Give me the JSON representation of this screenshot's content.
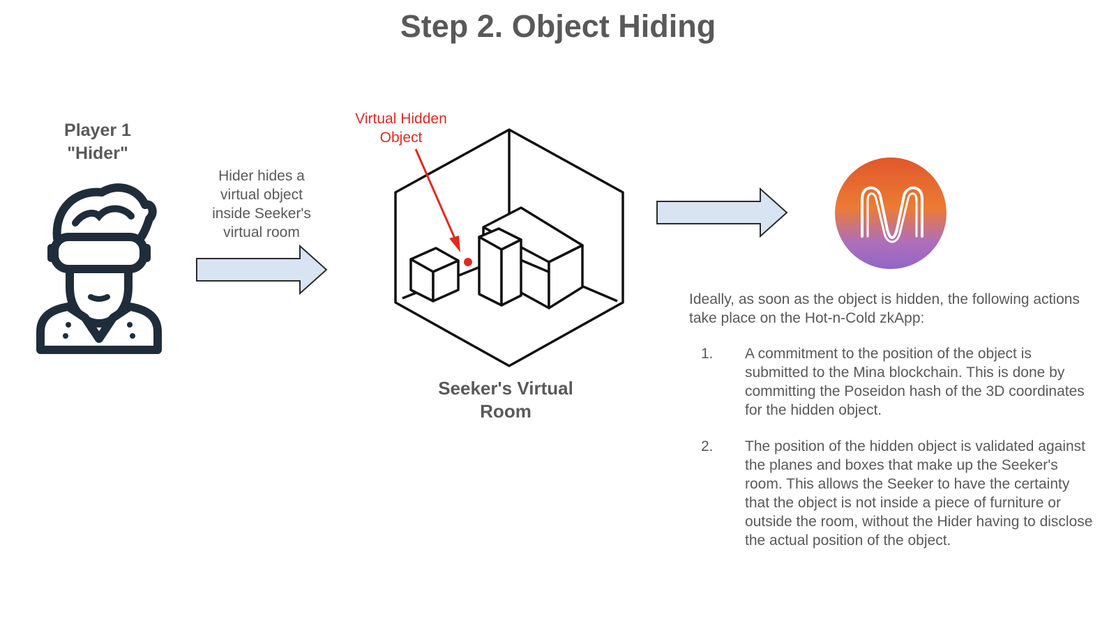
{
  "title": "Step 2. Object Hiding",
  "player": {
    "line1": "Player 1",
    "line2": "\"Hider\"",
    "icon": "vr-headset-user-icon"
  },
  "step_caption": {
    "lines": [
      "Hider hides a",
      "virtual object",
      "inside Seeker's",
      "virtual room"
    ]
  },
  "room": {
    "hidden_label": [
      "Virtual Hidden",
      "Object"
    ],
    "caption": [
      "Seeker's Virtual",
      "Room"
    ],
    "icon": "isometric-room-icon",
    "hidden_marker_color": "#e02a20"
  },
  "mina": {
    "icon": "mina-logo-icon",
    "gradient": [
      "#e0572a",
      "#ec7b34",
      "#b06fb8",
      "#9166c9"
    ]
  },
  "intro": "Ideally, as soon as the object is hidden, the following actions take place on the Hot-n-Cold zkApp:",
  "items": [
    {
      "number": "1.",
      "text": "A commitment to the position of the object is submitted to the Mina blockchain. This is done by committing the Poseidon hash of the 3D coordinates for the hidden object."
    },
    {
      "number": "2.",
      "text": "The position of the hidden object is validated against the planes and boxes that make up the Seeker's room. This allows the Seeker to have the certainty that the object is not inside a piece of furniture or outside the room, without the Hider having to disclose the actual position of the object."
    }
  ],
  "colors": {
    "arrow_fill": "#d9e4f2",
    "arrow_stroke": "#2b2b2b",
    "text": "#595959",
    "accent_red": "#e02a20"
  }
}
